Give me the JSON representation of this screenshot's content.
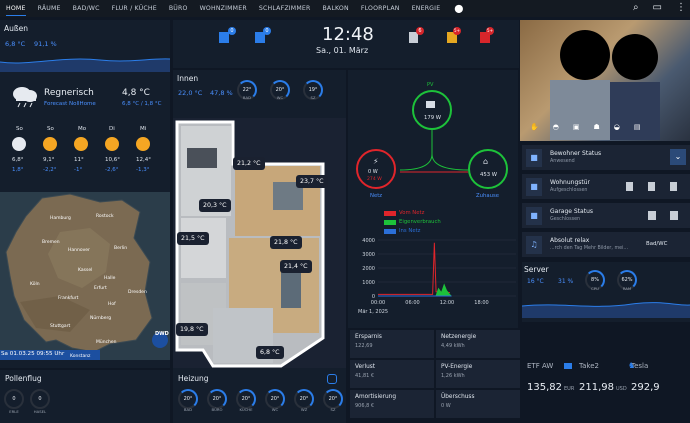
{
  "nav": {
    "tabs": [
      "HOME",
      "RÄUME",
      "BAD/WC",
      "FLUR / KÜCHE",
      "BÜRO",
      "WOHNZIMMER",
      "SCHLAFZIMMER",
      "BALKON",
      "FLOORPLAN",
      "ENERGIE"
    ]
  },
  "outside": {
    "title": "Außen",
    "temp": "6,8 °C",
    "hum": "91,1 %"
  },
  "weather": {
    "cond": "Regnerisch",
    "source": "Forecast NollHome",
    "temp": "4,8 °C",
    "range": "6,8 °C / 1,8 °C",
    "days": [
      {
        "d": "So",
        "hi": "6,8°",
        "lo": "1,8°"
      },
      {
        "d": "So",
        "hi": "9,1°",
        "lo": "-2,2°"
      },
      {
        "d": "Mo",
        "hi": "11°",
        "lo": "-1°"
      },
      {
        "d": "Di",
        "hi": "10,6°",
        "lo": "-2,6°"
      },
      {
        "d": "Mi",
        "hi": "12,4°",
        "lo": "-1,3°"
      }
    ]
  },
  "map": {
    "cities": [
      "Hamburg",
      "Rostock",
      "Bremen",
      "Hannover",
      "Berlin",
      "Kassel",
      "Halle",
      "Dresden",
      "Köln",
      "Frankfurt",
      "Nürnberg",
      "Stuttgart",
      "München",
      "Konstanz",
      "Erfurt",
      "Hof"
    ],
    "timestamp": "Sa 01.03.25 09:55 Uhr",
    "logo": "DWD"
  },
  "pollen": {
    "title": "Pollenflug",
    "items": [
      {
        "v": "0",
        "l": "ERLE"
      },
      {
        "v": "0",
        "l": "HASEL"
      }
    ]
  },
  "clock": {
    "time": "12:48",
    "date": "Sa., 01. März"
  },
  "badges": [
    "0",
    "0",
    "6",
    "5+",
    "5+"
  ],
  "inside": {
    "title": "Innen",
    "temp": "22,0 °C",
    "hum": "47,8 %",
    "gauges": [
      {
        "v": "22°",
        "l": "BAD"
      },
      {
        "v": "20°",
        "l": "WC"
      },
      {
        "v": "19°",
        "l": "SZ"
      }
    ]
  },
  "rooms": [
    {
      "t": "21,2 °C"
    },
    {
      "t": "23,7 °C"
    },
    {
      "t": "20,3 °C"
    },
    {
      "t": "21,5 °C"
    },
    {
      "t": "21,8 °C"
    },
    {
      "t": "21,4 °C"
    },
    {
      "t": "19,8 °C"
    },
    {
      "t": "6,8 °C"
    }
  ],
  "heating": {
    "title": "Heizung",
    "gauges": [
      {
        "v": "20°",
        "l": "BAD"
      },
      {
        "v": "20°",
        "l": "BÜRO"
      },
      {
        "v": "20°",
        "l": "KÜCHE"
      },
      {
        "v": "20°",
        "l": "WC"
      },
      {
        "v": "20°",
        "l": "WZ"
      },
      {
        "v": "20°",
        "l": "SZ"
      }
    ]
  },
  "energy": {
    "pv": {
      "label": "PV",
      "value": "179 W"
    },
    "grid": {
      "label": "Netz",
      "in": "0 W",
      "out": "274 W"
    },
    "home": {
      "label": "Zuhause",
      "value": "453 W"
    }
  },
  "chart_data": {
    "type": "line",
    "series": [
      {
        "name": "Vom Netz",
        "color": "#e0252b"
      },
      {
        "name": "Eigenverbrauch",
        "color": "#1dc23a"
      },
      {
        "name": "Ins Netz",
        "color": "#2b6fd8"
      }
    ],
    "x_labels": [
      "00:00",
      "06:00",
      "12:00",
      "18:00"
    ],
    "y_labels": [
      "4000",
      "3000",
      "2000",
      "1000",
      "0"
    ],
    "date": "Mär 1, 2025",
    "ylim": [
      0,
      4000
    ]
  },
  "stats": [
    {
      "l": "Ersparnis",
      "v": "122,69"
    },
    {
      "l": "Netzenergie",
      "v": "4,49 kWh"
    },
    {
      "l": "Verlust",
      "v": "41,81 €"
    },
    {
      "l": "PV-Energie",
      "v": "1,26 kWh"
    },
    {
      "l": "Amortisierung",
      "v": "906,8 €"
    },
    {
      "l": "Überschuss",
      "v": "0 W"
    }
  ],
  "status": [
    {
      "t": "Bewohner Status",
      "s": "Anwesend"
    },
    {
      "t": "Wohnungstür",
      "s": "Aufgeschlossen"
    },
    {
      "t": "Garage Status",
      "s": "Geschlossen"
    },
    {
      "t": "Absolut relax",
      "s": "...rch den Tag   Mehr Bilder, mei...",
      "extra": "Bad/WC"
    }
  ],
  "server": {
    "title": "Server",
    "temp": "16 °C",
    "pct": "31 %",
    "gauges": [
      {
        "v": "8%",
        "l": "CPU"
      },
      {
        "v": "62%",
        "l": "RAM"
      }
    ]
  },
  "finance": [
    {
      "n": "ETF AW",
      "v": "135,82",
      "c": "EUR"
    },
    {
      "n": "Take2",
      "v": "211,98",
      "c": "USD"
    },
    {
      "n": "Tesla",
      "v": "292,9",
      "c": ""
    }
  ]
}
